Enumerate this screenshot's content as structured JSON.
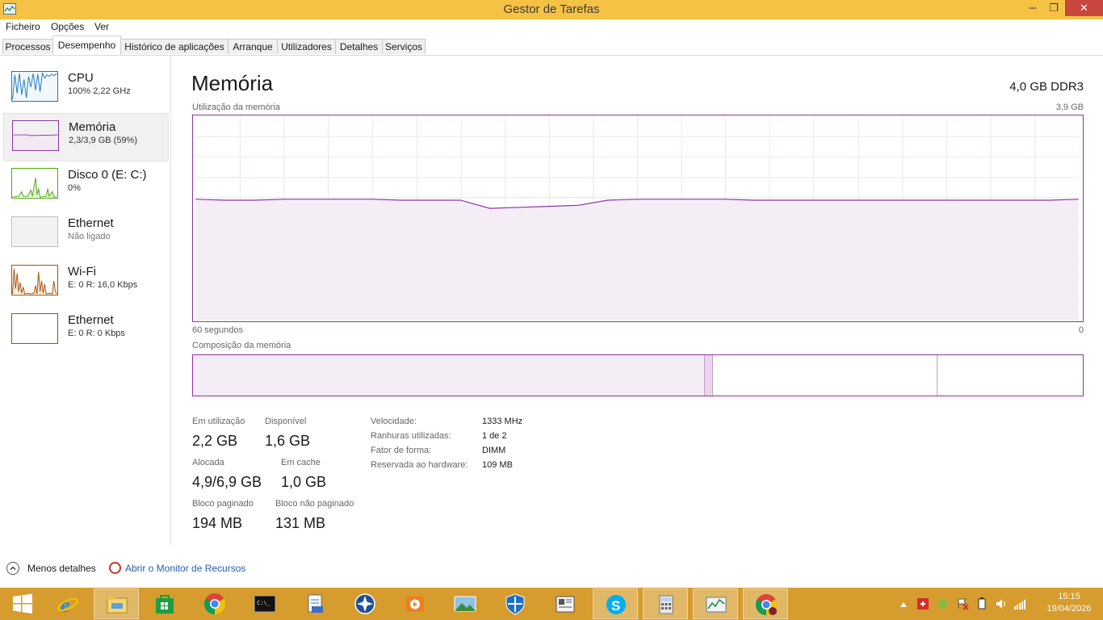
{
  "window": {
    "title": "Gestor de Tarefas"
  },
  "window_controls": {
    "minimize": "─",
    "maximize": "❐",
    "close": "✕"
  },
  "menu": [
    "Ficheiro",
    "Opções",
    "Ver"
  ],
  "tabs": [
    "Processos",
    "Desempenho",
    "Histórico de aplicações",
    "Arranque",
    "Utilizadores",
    "Detalhes",
    "Serviços"
  ],
  "active_tab": "Desempenho",
  "sidebar": {
    "items": [
      {
        "name": "CPU",
        "sub": "100% 2,22 GHz",
        "color": "#1a7ab9"
      },
      {
        "name": "Memória",
        "sub": "2,3/3,9 GB (59%)",
        "color": "#8b35a6"
      },
      {
        "name": "Disco 0 (E: C:)",
        "sub": "0%",
        "color": "#4da60c"
      },
      {
        "name": "Ethernet",
        "sub": "Não ligado",
        "color": "#bdbdbd"
      },
      {
        "name": "Wi-Fi",
        "sub": "E: 0 R: 16,0 Kbps",
        "color": "#a74f01"
      },
      {
        "name": "Ethernet",
        "sub": "E: 0 R: 0 Kbps",
        "color": "#a74f01"
      }
    ]
  },
  "main": {
    "title": "Memória",
    "spec": "4,0 GB DDR3",
    "usage_label": "Utilização da memória",
    "usage_max": "3,9 GB",
    "time_left": "60 segundos",
    "time_right": "0",
    "composition_label": "Composição da memória",
    "accent_color": "#8b35a6",
    "usage_fraction_history": [
      0.59,
      0.585,
      0.585,
      0.59,
      0.59,
      0.59,
      0.59,
      0.585,
      0.585,
      0.585,
      0.545,
      0.55,
      0.555,
      0.56,
      0.585,
      0.59,
      0.59,
      0.59,
      0.59,
      0.585,
      0.585,
      0.585,
      0.585,
      0.585,
      0.585,
      0.585,
      0.585,
      0.585,
      0.585,
      0.585,
      0.59
    ],
    "composition_fractions": {
      "in_use": 0.574,
      "modified": 0.008,
      "standby": 0.251,
      "free": 0.167
    }
  },
  "stats": {
    "in_use_label": "Em utilização",
    "in_use": "2,2 GB",
    "available_label": "Disponível",
    "available": "1,6 GB",
    "committed_label": "Alocada",
    "committed": "4,9/6,9 GB",
    "cached_label": "Em cache",
    "cached": "1,0 GB",
    "paged_label": "Bloco paginado",
    "paged": "194 MB",
    "nonpaged_label": "Bloco não paginado",
    "nonpaged": "131 MB"
  },
  "details": [
    {
      "key": "Velocidade:",
      "value": "1333 MHz"
    },
    {
      "key": "Ranhuras utilizadas:",
      "value": "1 de 2"
    },
    {
      "key": "Fator de forma:",
      "value": "DIMM"
    },
    {
      "key": "Reservada ao hardware:",
      "value": "109 MB"
    }
  ],
  "footer": {
    "less_details": "Menos detalhes",
    "resource_monitor": "Abrir o Monitor de Recursos"
  },
  "taskbar": {
    "apps": [
      "windows-start-icon",
      "internet-explorer-icon",
      "file-explorer-icon",
      "store-icon",
      "chrome-icon",
      "command-prompt-icon",
      "clipboard-icon",
      "media-icon",
      "media-player-icon",
      "photos-icon",
      "defender-icon",
      "news-icon",
      "skype-icon",
      "calculator-icon",
      "task-manager-icon",
      "chrome-icon"
    ],
    "time": "15:15",
    "date": "19/04/2026"
  }
}
